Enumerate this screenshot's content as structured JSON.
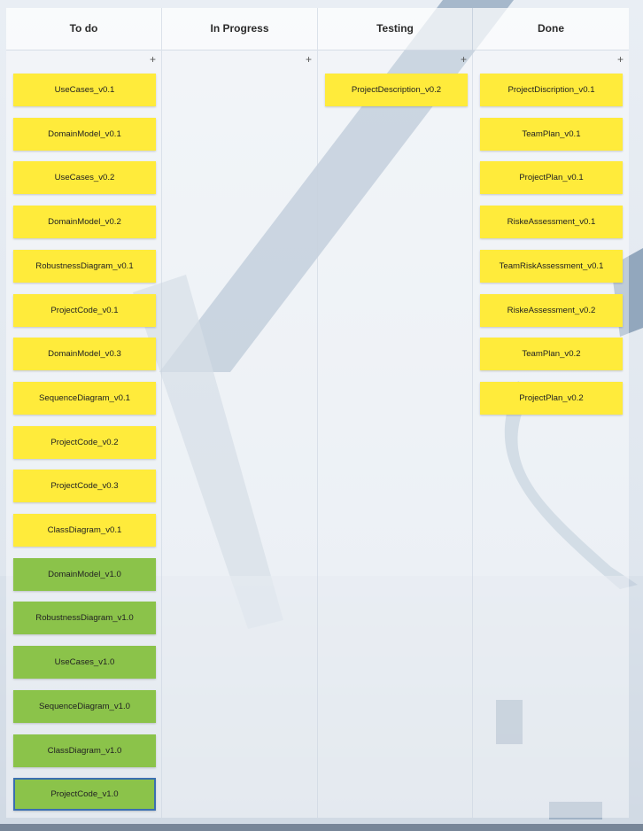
{
  "columns": [
    {
      "title": "To do",
      "add": "+",
      "cards": [
        {
          "label": "UseCases_v0.1",
          "color": "yellow"
        },
        {
          "label": "DomainModel_v0.1",
          "color": "yellow"
        },
        {
          "label": "UseCases_v0.2",
          "color": "yellow"
        },
        {
          "label": "DomainModel_v0.2",
          "color": "yellow"
        },
        {
          "label": "RobustnessDiagram_v0.1",
          "color": "yellow"
        },
        {
          "label": "ProjectCode_v0.1",
          "color": "yellow"
        },
        {
          "label": "DomainModel_v0.3",
          "color": "yellow"
        },
        {
          "label": "SequenceDiagram_v0.1",
          "color": "yellow"
        },
        {
          "label": "ProjectCode_v0.2",
          "color": "yellow"
        },
        {
          "label": "ProjectCode_v0.3",
          "color": "yellow"
        },
        {
          "label": "ClassDiagram_v0.1",
          "color": "yellow"
        },
        {
          "label": "DomainModel_v1.0",
          "color": "green"
        },
        {
          "label": "RobustnessDiagram_v1.0",
          "color": "green"
        },
        {
          "label": "UseCases_v1.0",
          "color": "green"
        },
        {
          "label": "SequenceDiagram_v1.0",
          "color": "green"
        },
        {
          "label": "ClassDiagram_v1.0",
          "color": "green"
        },
        {
          "label": "ProjectCode_v1.0",
          "color": "green",
          "selected": true
        }
      ]
    },
    {
      "title": "In Progress",
      "add": "+",
      "cards": []
    },
    {
      "title": "Testing",
      "add": "+",
      "cards": [
        {
          "label": "ProjectDescription_v0.2",
          "color": "yellow"
        }
      ]
    },
    {
      "title": "Done",
      "add": "+",
      "cards": [
        {
          "label": "ProjectDiscription_v0.1",
          "color": "yellow"
        },
        {
          "label": "TeamPlan_v0.1",
          "color": "yellow"
        },
        {
          "label": "ProjectPlan_v0.1",
          "color": "yellow"
        },
        {
          "label": "RiskeAssessment_v0.1",
          "color": "yellow"
        },
        {
          "label": "TeamRiskAssessment_v0.1",
          "color": "yellow"
        },
        {
          "label": "RiskeAssessment_v0.2",
          "color": "yellow"
        },
        {
          "label": "TeamPlan_v0.2",
          "color": "yellow"
        },
        {
          "label": "ProjectPlan_v0.2",
          "color": "yellow"
        }
      ]
    }
  ],
  "colors": {
    "yellow": "#ffeb3b",
    "green": "#8bc34a",
    "selected_border": "#3a6fb0"
  }
}
